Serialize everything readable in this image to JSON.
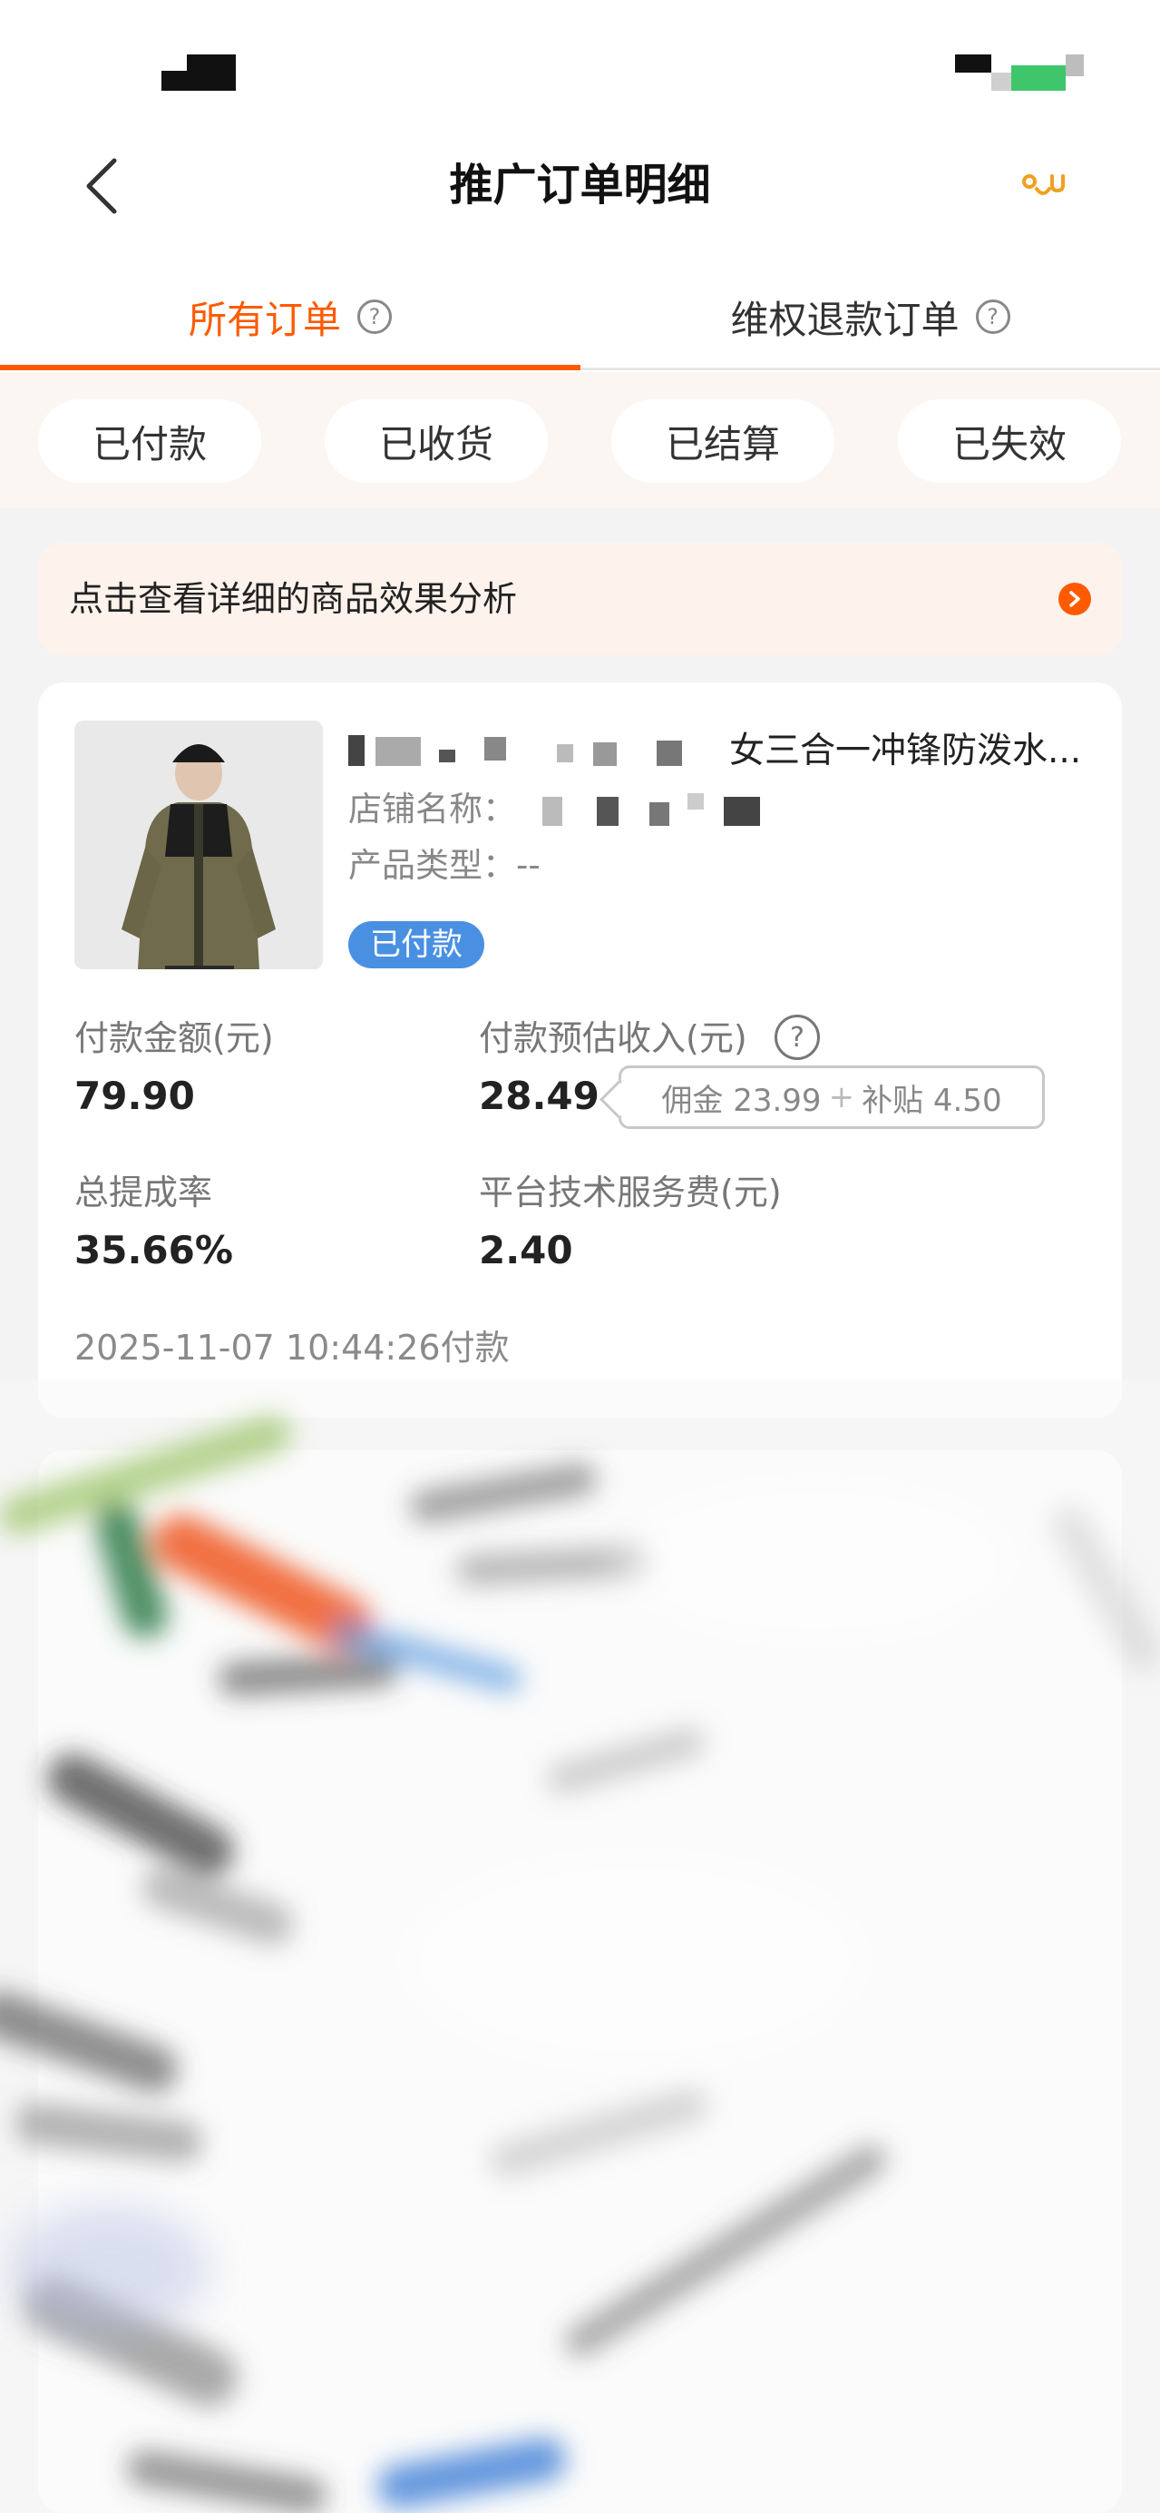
{
  "nav": {
    "title": "推广订单明细",
    "back_icon": "chevron-left-icon",
    "service_icon": "customer-service-icon",
    "accent_color": "#ff5a00"
  },
  "tabs": [
    {
      "label": "所有订单",
      "active": true
    },
    {
      "label": "维权退款订单",
      "active": false
    }
  ],
  "filters": [
    "已付款",
    "已收货",
    "已结算",
    "已失效"
  ],
  "banner": {
    "text": "点击查看详细的商品效果分析"
  },
  "order": {
    "title_visible": "女三合一冲锋防泼水...",
    "shop_label": "店铺名称：",
    "type_label": "产品类型：",
    "type_value": "--",
    "status": "已付款",
    "pay_amount_label": "付款金额(元)",
    "pay_amount": "79.90",
    "est_income_label": "付款预估收入(元)",
    "est_income": "28.49",
    "commission_detail": "佣金 23.99",
    "plus": "+",
    "subsidy_detail": "补贴 4.50",
    "rate_label": "总提成率",
    "rate": "35.66%",
    "fee_label": "平台技术服务费(元)",
    "fee": "2.40",
    "pay_time": "2025-11-07 10:44:26付款"
  }
}
